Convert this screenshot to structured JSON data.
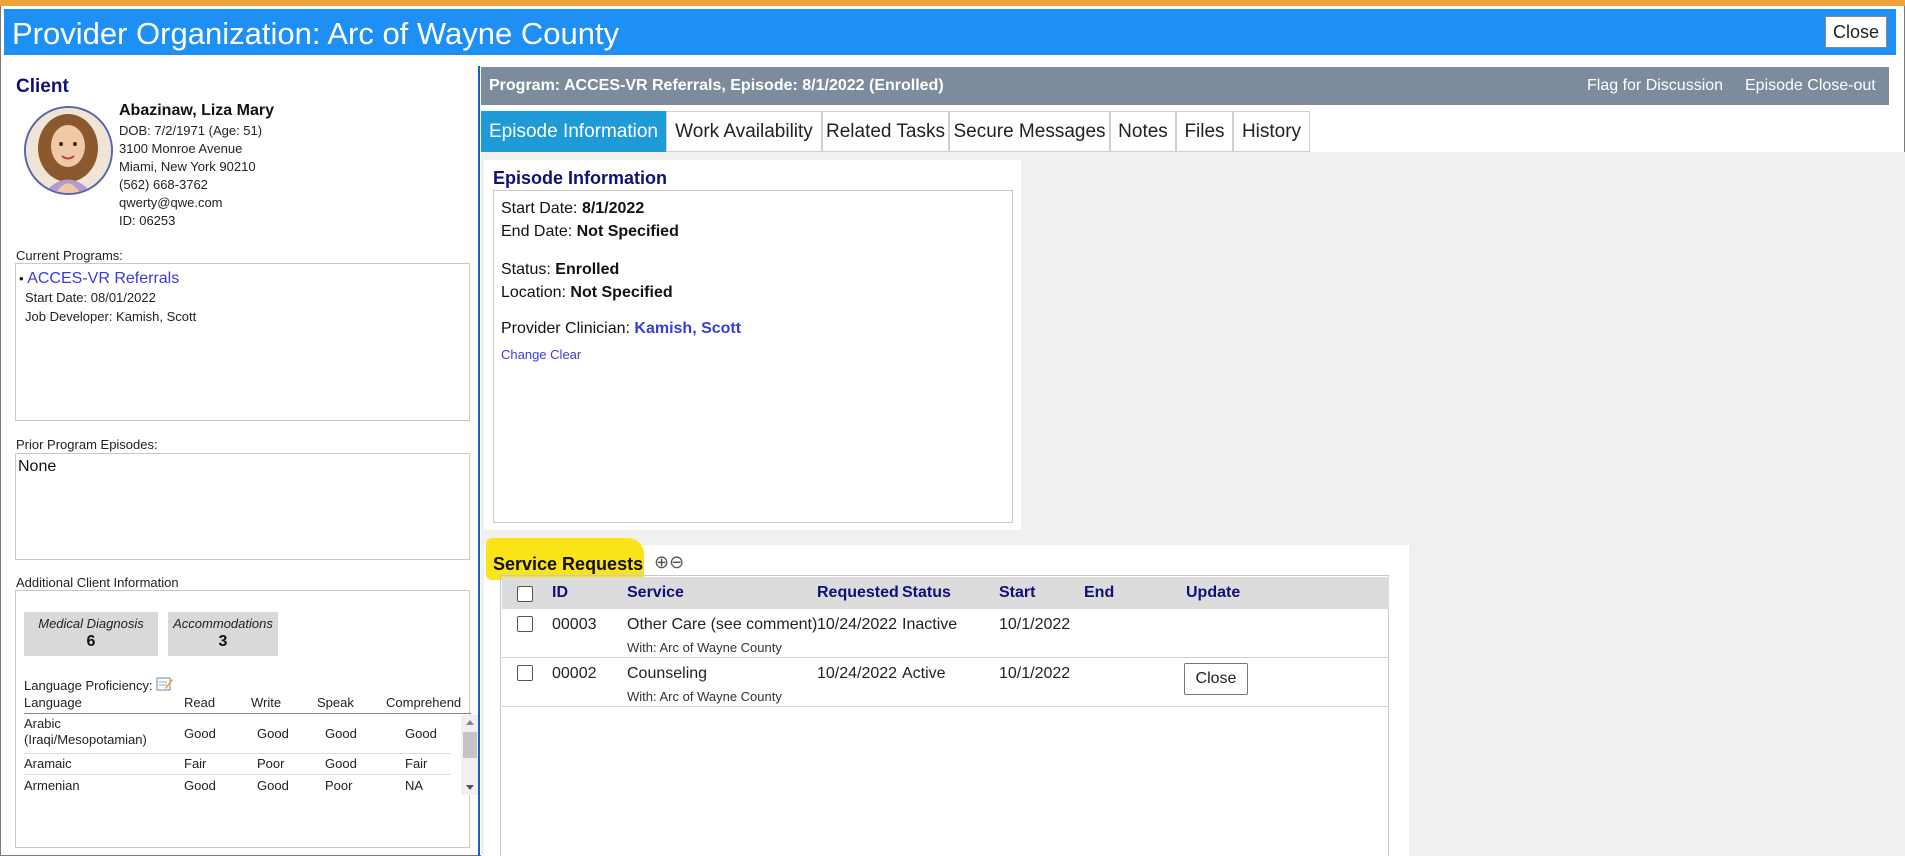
{
  "header": {
    "title": "Provider Organization: Arc of Wayne County",
    "close_label": "Close"
  },
  "client": {
    "section_title": "Client",
    "name": "Abazinaw, Liza Mary",
    "dob": "DOB: 7/2/1971 (Age: 51)",
    "address1": "3100 Monroe Avenue",
    "address2": "Miami, New York 90210",
    "phone": "(562) 668-3762",
    "email": "qwerty@qwe.com",
    "id": "ID: 06253",
    "current_programs_label": "Current Programs:",
    "current_program": {
      "bullet": "•",
      "name": "ACCES-VR Referrals",
      "start_date": "Start Date: 08/01/2022",
      "job_developer": "Job Developer: Kamish, Scott"
    },
    "prior_label": "Prior Program Episodes:",
    "prior_value": "None",
    "additional_label": "Additional Client Information",
    "tiles": [
      {
        "label": "Medical Diagnosis",
        "value": "6"
      },
      {
        "label": "Accommodations",
        "value": "3"
      }
    ],
    "language_label": "Language Proficiency:",
    "language_headers": [
      "Language",
      "Read",
      "Write",
      "Speak",
      "Comprehend"
    ],
    "languages": [
      {
        "language": "Arabic (Iraqi/Mesopotamian)",
        "read": "Good",
        "write": "Good",
        "speak": "Good",
        "comprehend": "Good"
      },
      {
        "language": "Aramaic",
        "read": "Fair",
        "write": "Poor",
        "speak": "Good",
        "comprehend": "Fair"
      },
      {
        "language": "Armenian",
        "read": "Good",
        "write": "Good",
        "speak": "Poor",
        "comprehend": "NA"
      }
    ]
  },
  "program_bar": {
    "title": "Program: ACCES-VR Referrals, Episode: 8/1/2022 (Enrolled)",
    "flag_label": "Flag for Discussion",
    "closeout_label": "Episode Close-out"
  },
  "tabs": [
    {
      "label": "Episode Information",
      "active": true
    },
    {
      "label": "Work Availability"
    },
    {
      "label": "Related Tasks"
    },
    {
      "label": "Secure Messages"
    },
    {
      "label": "Notes"
    },
    {
      "label": "Files"
    },
    {
      "label": "History"
    }
  ],
  "episode": {
    "title": "Episode Information",
    "start_label": "Start Date:",
    "start_value": "8/1/2022",
    "end_label": "End Date:",
    "end_value": "Not Specified",
    "status_label": "Status:",
    "status_value": "Enrolled",
    "location_label": "Location:",
    "location_value": "Not Specified",
    "clinician_label": "Provider Clinician:",
    "clinician_value": "Kamish, Scott",
    "change_label": "Change",
    "clear_label": "Clear"
  },
  "service_requests": {
    "title": "Service Requests",
    "add_icon": "⊕",
    "remove_icon": "⊖",
    "headers": {
      "id": "ID",
      "service": "Service",
      "requested": "Requested",
      "status": "Status",
      "start": "Start",
      "end": "End",
      "update": "Update"
    },
    "rows": [
      {
        "id": "00003",
        "service": "Other Care (see comment)",
        "with": "With: Arc of Wayne County",
        "requested": "10/24/2022",
        "status": "Inactive",
        "start": "10/1/2022",
        "end": "",
        "button": ""
      },
      {
        "id": "00002",
        "service": "Counseling",
        "with": "With: Arc of Wayne County",
        "requested": "10/24/2022",
        "status": "Active",
        "start": "10/1/2022",
        "end": "",
        "button": "Close"
      }
    ]
  },
  "colors": {
    "title_bar": "#1e90f5",
    "accent_stripe": "#f0a33a",
    "program_bar": "#7c8c9c",
    "active_tab": "#1e9ad6",
    "highlight": "#fbe319",
    "link": "#3b3bdd",
    "heading": "#10107a"
  }
}
